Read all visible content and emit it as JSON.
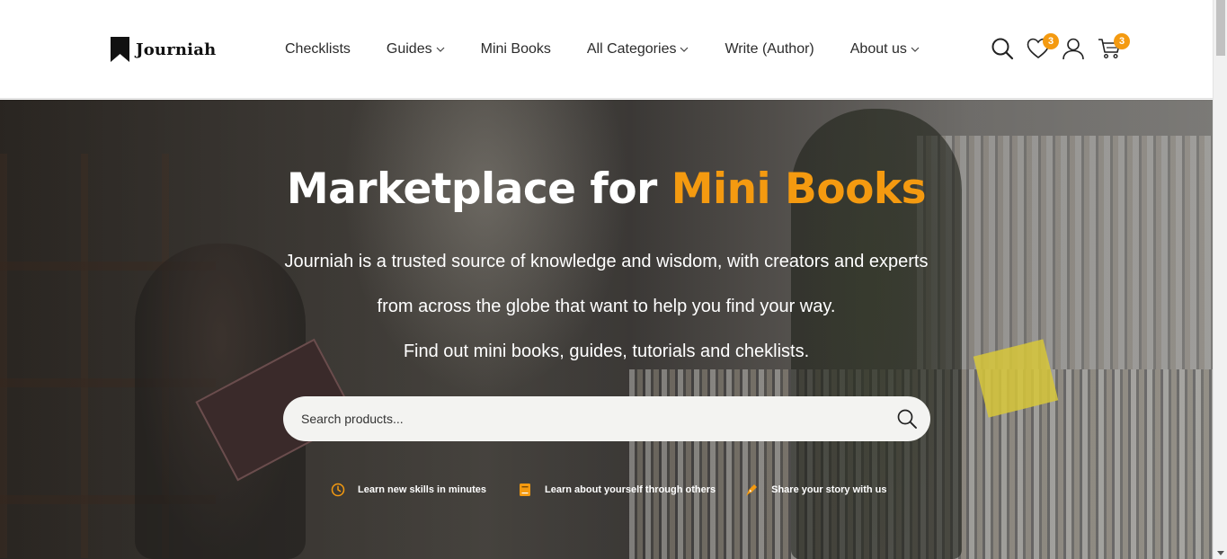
{
  "header": {
    "logo_text": "Journiah",
    "nav": [
      {
        "label": "Checklists",
        "has_dropdown": false
      },
      {
        "label": "Guides",
        "has_dropdown": true
      },
      {
        "label": "Mini Books",
        "has_dropdown": false
      },
      {
        "label": "All Categories",
        "has_dropdown": true
      },
      {
        "label": "Write (Author)",
        "has_dropdown": false
      },
      {
        "label": "About us",
        "has_dropdown": true
      }
    ],
    "icons": {
      "search": "search-icon",
      "wishlist": "heart-icon",
      "account": "user-icon",
      "cart": "cart-icon"
    },
    "wishlist_count": "3",
    "cart_count": "3"
  },
  "hero": {
    "title_main": "Marketplace for ",
    "title_accent": "Mini Books",
    "line1": "Journiah is a trusted source of knowledge and wisdom, with creators and experts",
    "line2": "from across the globe that want to help you find your way.",
    "line3": "Find out mini books, guides, tutorials and cheklists.",
    "search_placeholder": "Search products...",
    "features": [
      {
        "icon": "clock-icon",
        "label": "Learn new skills in minutes"
      },
      {
        "icon": "book-icon",
        "label": "Learn about yourself through others"
      },
      {
        "icon": "pen-icon",
        "label": "Share your story with us"
      }
    ]
  },
  "colors": {
    "accent": "#f49a10",
    "text_dark": "#2b2b2b",
    "hero_text": "#ffffff"
  }
}
